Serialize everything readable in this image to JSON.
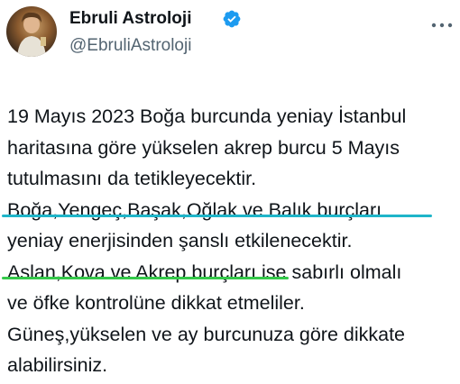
{
  "author": {
    "display_name": "Ebruli Astroloji",
    "handle": "@EbruliAstroloji",
    "verified": true,
    "avatar_icon": "profile-photo"
  },
  "more_icon": "more-options-icon",
  "tweet": {
    "lines": [
      "19 Mayıs 2023 Boğa burcunda yeniay İstanbul",
      "haritasına göre yükselen akrep burcu 5 Mayıs",
      "tutulmasını da tetikleyecektir.",
      "Boğa,Yengeç,Başak,Oğlak ve Balık burçları",
      "yeniay enerjisinden şanslı etkilenecektir.",
      "Aslan,Kova ve Akrep burçları ise sabırlı olmalı",
      "ve öfke kontrolüne dikkat etmeliler.",
      "Güneş,yükselen ve ay burcunuza göre dikkate",
      "alabilirsiniz."
    ]
  },
  "colors": {
    "verified_badge": "#1d9bf0",
    "underline_line4": "#1fb5c9",
    "underline_line6": "#34c94a",
    "handle_text": "#536471"
  }
}
